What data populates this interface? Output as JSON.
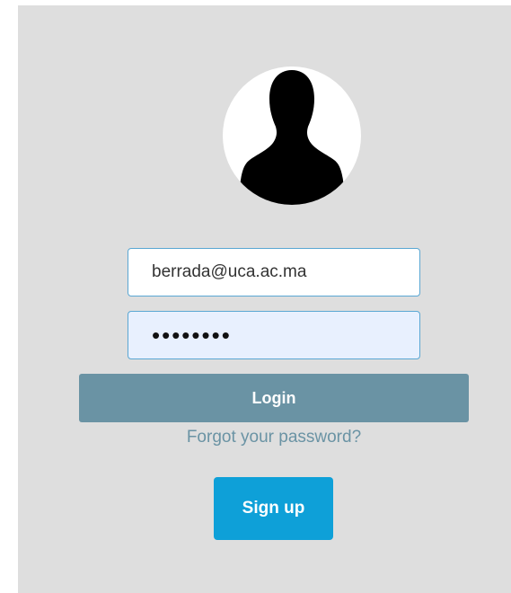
{
  "login_form": {
    "avatar_icon": "user-silhouette-icon",
    "email": {
      "value": "berrada@uca.ac.ma",
      "placeholder": ""
    },
    "password": {
      "masked_value": "••••••••",
      "placeholder": ""
    },
    "login_label": "Login",
    "forgot_label": "Forgot your password?",
    "signup_label": "Sign up"
  },
  "colors": {
    "panel_background": "#dedede",
    "login_button": "#6a93a4",
    "signup_button": "#0ea0d8",
    "link": "#6a93a4",
    "field_border": "#5aa7d3",
    "password_field_fill": "#e8f0fe"
  }
}
